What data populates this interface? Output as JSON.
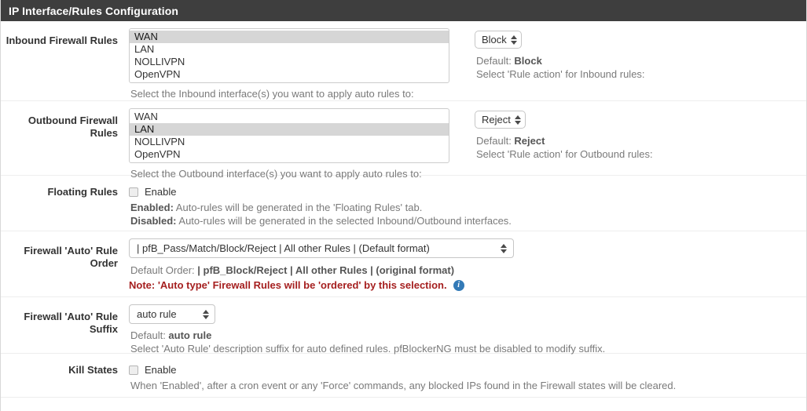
{
  "panel": {
    "title": "IP Interface/Rules Configuration",
    "header_bg": "#3e3e3e"
  },
  "icons": {
    "info": "i"
  },
  "rows": {
    "inbound": {
      "label": "Inbound Firewall Rules",
      "options": [
        "WAN",
        "LAN",
        "NOLLIVPN",
        "OpenVPN"
      ],
      "selected": "WAN",
      "help": "Select the Inbound interface(s) you want to apply auto rules to:",
      "action_value": "Block",
      "default_prefix": "Default: ",
      "default_value": "Block",
      "action_help": "Select 'Rule action' for Inbound rules:"
    },
    "outbound": {
      "label": "Outbound Firewall Rules",
      "options": [
        "WAN",
        "LAN",
        "NOLLIVPN",
        "OpenVPN"
      ],
      "selected": "LAN",
      "help": "Select the Outbound interface(s) you want to apply auto rules to:",
      "action_value": "Reject",
      "default_prefix": "Default: ",
      "default_value": "Reject",
      "action_help": "Select 'Rule action' for Outbound rules:"
    },
    "floating": {
      "label": "Floating Rules",
      "checkbox_label": "Enable",
      "checked": false,
      "help_enabled_key": "Enabled:",
      "help_enabled_text": " Auto-rules will be generated in the 'Floating Rules' tab.",
      "help_disabled_key": "Disabled:",
      "help_disabled_text": " Auto-rules will be generated in the selected Inbound/Outbound interfaces."
    },
    "rule_order": {
      "label": "Firewall 'Auto' Rule Order",
      "value": "| pfB_Pass/Match/Block/Reject | All other Rules | (Default format)",
      "default_prefix": "Default Order: ",
      "default_value": "| pfB_Block/Reject | All other Rules | (original format)",
      "note": "Note: 'Auto type' Firewall Rules will be 'ordered' by this selection."
    },
    "rule_suffix": {
      "label": "Firewall 'Auto' Rule Suffix",
      "value": "auto rule",
      "default_prefix": "Default: ",
      "default_value": "auto rule",
      "help": "Select 'Auto Rule' description suffix for auto defined rules. pfBlockerNG must be disabled to modify suffix."
    },
    "kill_states": {
      "label": "Kill States",
      "checkbox_label": "Enable",
      "checked": false,
      "help": "When 'Enabled', after a cron event or any 'Force' commands, any blocked IPs found in the Firewall states will be cleared."
    }
  }
}
